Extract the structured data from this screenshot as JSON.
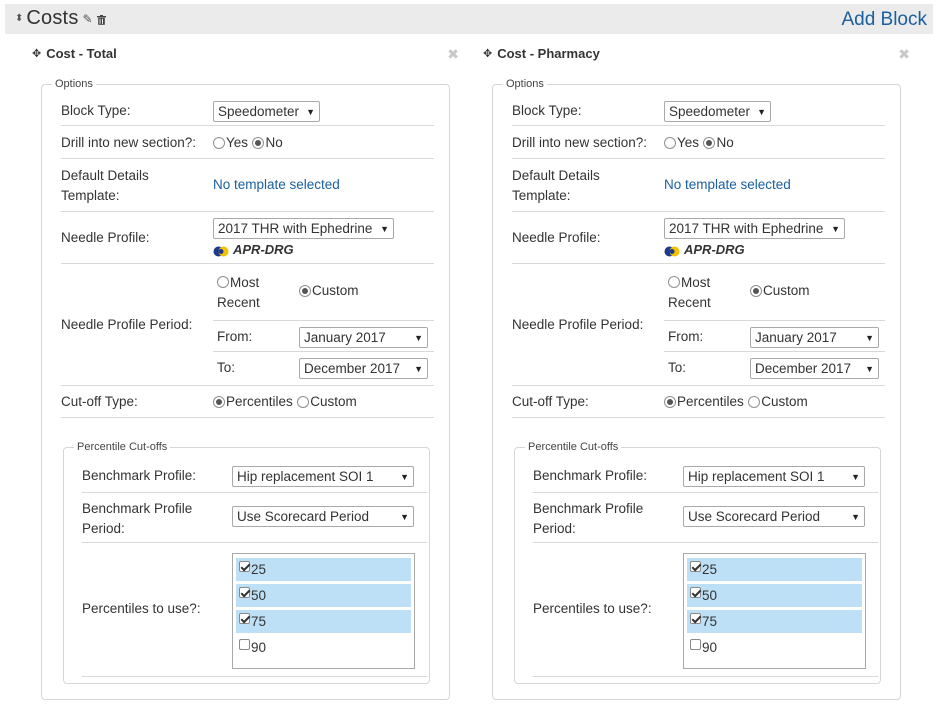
{
  "section": {
    "title": "Costs",
    "add_block_label": "Add Block"
  },
  "blocks": [
    {
      "title": "Cost - Total",
      "close_icon": "✖",
      "options_legend": "Options",
      "block_type_label": "Block Type:",
      "block_type_value": "Speedometer",
      "drill_label": "Drill into new section?:",
      "drill_yes": "Yes",
      "drill_no": "No",
      "drill_selected": "No",
      "template_label_1": "Default Details",
      "template_label_2": "Template:",
      "template_value": "No template selected",
      "needle_label": "Needle Profile:",
      "needle_value": "2017 THR with Ephedrine",
      "needle_grouper": "APR-DRG",
      "period_label": "Needle Profile Period:",
      "period_most_recent_1": "Most",
      "period_most_recent_2": "Recent",
      "period_custom": "Custom",
      "period_selected": "Custom",
      "from_label": "From:",
      "from_value": "January 2017",
      "to_label": "To:",
      "to_value": "December 2017",
      "cutoff_label": "Cut-off Type:",
      "cutoff_percentiles": "Percentiles",
      "cutoff_custom": "Custom",
      "cutoff_selected": "Percentiles",
      "pct_legend": "Percentile Cut-offs",
      "bench_label": "Benchmark Profile:",
      "bench_value": "Hip replacement SOI 1",
      "bench_period_label_1": "Benchmark Profile",
      "bench_period_label_2": "Period:",
      "bench_period_value": "Use Scorecard Period",
      "pct_use_label": "Percentiles to use?:",
      "percentiles": [
        {
          "label": "25",
          "checked": true
        },
        {
          "label": "50",
          "checked": true
        },
        {
          "label": "75",
          "checked": true
        },
        {
          "label": "90",
          "checked": false
        }
      ]
    },
    {
      "title": "Cost - Pharmacy",
      "close_icon": "✖",
      "options_legend": "Options",
      "block_type_label": "Block Type:",
      "block_type_value": "Speedometer",
      "drill_label": "Drill into new section?:",
      "drill_yes": "Yes",
      "drill_no": "No",
      "drill_selected": "No",
      "template_label_1": "Default Details",
      "template_label_2": "Template:",
      "template_value": "No template selected",
      "needle_label": "Needle Profile:",
      "needle_value": "2017 THR with Ephedrine",
      "needle_grouper": "APR-DRG",
      "period_label": "Needle Profile Period:",
      "period_most_recent_1": "Most",
      "period_most_recent_2": "Recent",
      "period_custom": "Custom",
      "period_selected": "Custom",
      "from_label": "From:",
      "from_value": "January 2017",
      "to_label": "To:",
      "to_value": "December 2017",
      "cutoff_label": "Cut-off Type:",
      "cutoff_percentiles": "Percentiles",
      "cutoff_custom": "Custom",
      "cutoff_selected": "Percentiles",
      "pct_legend": "Percentile Cut-offs",
      "bench_label": "Benchmark Profile:",
      "bench_value": "Hip replacement SOI 1",
      "bench_period_label_1": "Benchmark Profile",
      "bench_period_label_2": "Period:",
      "bench_period_value": "Use Scorecard Period",
      "pct_use_label": "Percentiles to use?:",
      "percentiles": [
        {
          "label": "25",
          "checked": true
        },
        {
          "label": "50",
          "checked": true
        },
        {
          "label": "75",
          "checked": true
        },
        {
          "label": "90",
          "checked": false
        }
      ]
    }
  ],
  "icons": {
    "section_drag": "sort-arrows-icon",
    "edit": "pencil-icon",
    "delete": "trash-icon",
    "move": "move-icon",
    "close": "close-icon",
    "grouper": "apr-drg-logo-icon"
  },
  "colors": {
    "link": "#1a5fa0",
    "header_bg": "#ebebeb",
    "selected_item": "#bde0f6"
  }
}
